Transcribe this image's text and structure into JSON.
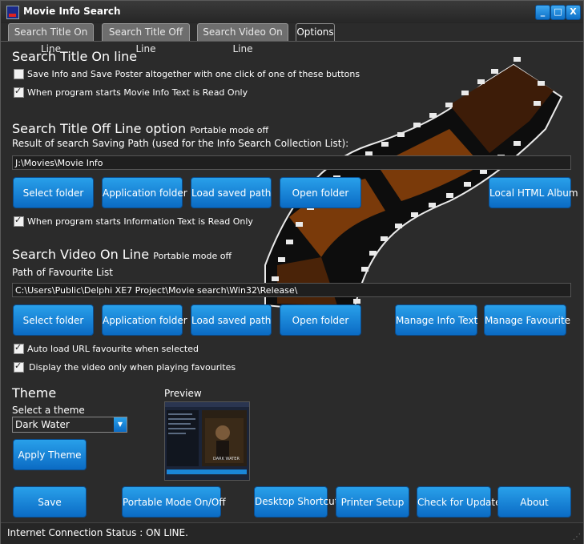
{
  "window": {
    "title": "Movie Info Search",
    "minimize": "_",
    "maximize": "□",
    "close": "X"
  },
  "tabs": [
    {
      "label": "Search Title On Line"
    },
    {
      "label": "Search Title Off Line"
    },
    {
      "label": "Search Video On Line"
    },
    {
      "label": "Options"
    }
  ],
  "online": {
    "heading": "Search Title On line",
    "check1": {
      "label": "Save Info and Save Poster altogether with one click of one of these buttons",
      "checked": false
    },
    "check2": {
      "label": "When program starts Movie Info Text is Read Only",
      "checked": true
    }
  },
  "offline": {
    "heading": "Search Title Off Line option",
    "mode": "Portable mode off",
    "path_label": "Result of search Saving Path (used for the Info Search Collection List):",
    "path_value": "J:\\Movies\\Movie Info",
    "buttons": {
      "select_folder": "Select folder",
      "application_folder": "Application folder",
      "load_saved_path": "Load saved path",
      "open_folder": "Open folder",
      "local_html_album": "Local HTML Album"
    },
    "check": {
      "label": "When program starts Information Text is Read Only",
      "checked": true
    }
  },
  "video": {
    "heading": "Search Video On Line",
    "mode": "Portable mode off",
    "path_label": "Path of Favourite List",
    "path_value": "C:\\Users\\Public\\Delphi XE7 Project\\Movie search\\Win32\\Release\\",
    "buttons": {
      "select_folder": "Select folder",
      "application_folder": "Application folder",
      "load_saved_path": "Load saved path",
      "open_folder": "Open folder",
      "manage_info_text": "Manage Info Text",
      "manage_favourite": "Manage Favourite"
    },
    "check1": {
      "label": "Auto load URL favourite when selected",
      "checked": true
    },
    "check2": {
      "label": "Display the video only when playing favourites",
      "checked": true
    }
  },
  "theme": {
    "heading": "Theme",
    "select_label": "Select a theme",
    "selected": "Dark Water",
    "apply": "Apply Theme",
    "preview_label": "Preview",
    "preview_caption": "DARK WATER"
  },
  "bottom_buttons": {
    "save": "Save",
    "portable_mode": "Portable Mode On/Off",
    "desktop_shortcut": "Desktop Shortcut",
    "printer_setup": "Printer Setup",
    "check_update": "Check for Update",
    "about": "About"
  },
  "status": {
    "text": "Internet Connection Status : ON LINE."
  },
  "colors": {
    "accent": "#1a86d9",
    "background": "#2b2b2b"
  }
}
